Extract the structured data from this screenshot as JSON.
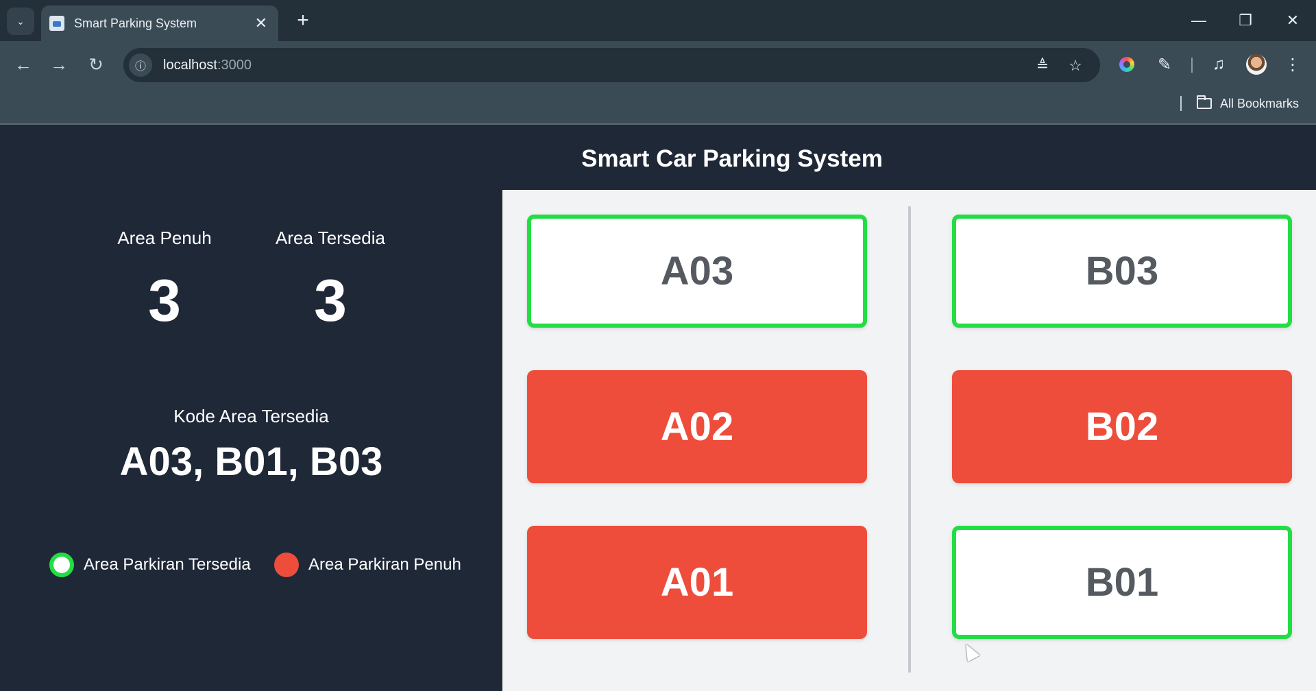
{
  "browser": {
    "tab_title": "Smart Parking System",
    "url_host": "localhost",
    "url_port": ":3000",
    "bookmarks_label": "All Bookmarks",
    "icons": {
      "tab_search": "chevron-down-icon",
      "close_tab": "close-icon",
      "new_tab": "plus-icon",
      "minimize": "minimize-icon",
      "restore": "restore-icon",
      "close_window": "close-icon",
      "back": "arrow-left-icon",
      "forward": "arrow-right-icon",
      "reload": "reload-icon",
      "site_info": "info-icon",
      "translate": "translate-icon",
      "bookmark": "star-icon",
      "color_extension": "color-ring-icon",
      "extensions": "puzzle-icon",
      "media": "media-icon",
      "profile": "avatar-icon",
      "menu": "kebab-menu-icon",
      "bookmarks_folder": "folder-icon"
    }
  },
  "page": {
    "title": "Smart Car Parking System",
    "stats": {
      "full_label": "Area Penuh",
      "full_value": "3",
      "available_label": "Area Tersedia",
      "available_value": "3"
    },
    "available_codes_label": "Kode Area Tersedia",
    "available_codes_value": "A03, B01, B03",
    "legend": {
      "free_label": "Area Parkiran Tersedia",
      "full_label": "Area Parkiran Penuh"
    },
    "colors": {
      "free_border": "#22dd44",
      "full_fill": "#ee4d3c",
      "panel_bg": "#1f2837",
      "lot_bg": "#f2f3f5"
    },
    "slots": [
      {
        "code": "A03",
        "status": "free"
      },
      {
        "code": "B03",
        "status": "free"
      },
      {
        "code": "A02",
        "status": "full"
      },
      {
        "code": "B02",
        "status": "full"
      },
      {
        "code": "A01",
        "status": "full"
      },
      {
        "code": "B01",
        "status": "free"
      }
    ]
  }
}
